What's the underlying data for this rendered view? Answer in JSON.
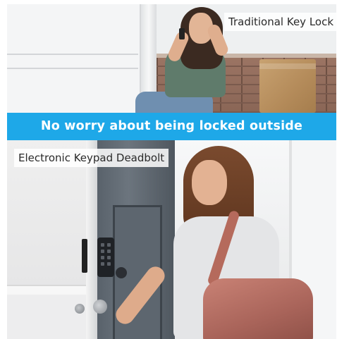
{
  "top_panel": {
    "label": "Traditional Key Lock"
  },
  "banner": {
    "text": "No worry about being locked outside",
    "color": "#1ea8e8"
  },
  "bottom_panel": {
    "label": "Electronic Keypad Deadbolt"
  }
}
